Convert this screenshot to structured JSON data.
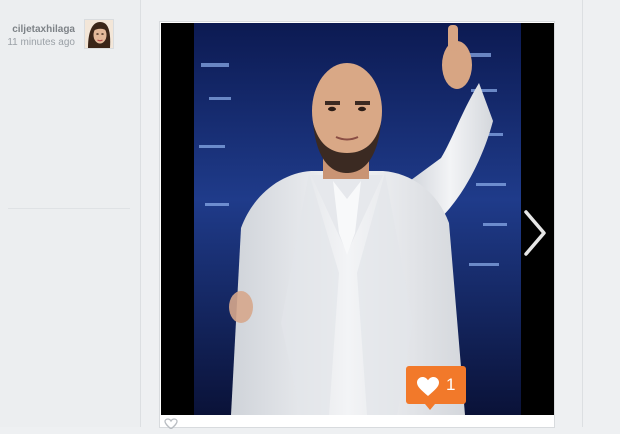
{
  "post": {
    "username": "ciljetaxhilaga",
    "timestamp": "11 minutes ago",
    "likes": "1"
  },
  "icons": {
    "next": "chevron-right-icon",
    "like": "heart-icon",
    "action_like": "heart-outline-icon"
  },
  "colors": {
    "like_badge": "#f2792a",
    "username": "#7d8287",
    "timestamp": "#9aa0a6",
    "background": "#eef0f2"
  }
}
